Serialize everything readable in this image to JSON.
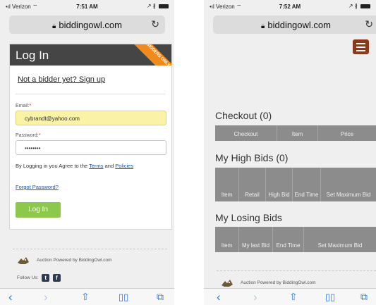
{
  "left": {
    "status": {
      "carrier": "Verizon",
      "time": "7:51 AM"
    },
    "url": "biddingowl.com",
    "login": {
      "title": "Log In",
      "ribbon": "BIDDERS ONLY",
      "signup_link": "Not a bidder yet? Sign up",
      "email_label": "Email:",
      "email_value": "cybrandt@yahoo.com",
      "password_label": "Password:",
      "password_value": "••••••••",
      "terms_prefix": "By Logging in you Agree to the",
      "terms_link": "Terms",
      "terms_and": "and",
      "policies_link": "Policies",
      "forgot_link": "Forgot Password?",
      "login_button": "Log In"
    },
    "footer": {
      "powered_by": "Auction Powered by BiddingOwl.com",
      "follow_us": "Follow Us:"
    }
  },
  "right": {
    "status": {
      "carrier": "Verizon",
      "time": "7:52 AM"
    },
    "url": "biddingowl.com",
    "checkout": {
      "title": "Checkout (0)",
      "columns": [
        "Checkout",
        "Item",
        "Price"
      ]
    },
    "high_bids": {
      "title": "My High Bids (0)",
      "columns": [
        "Item",
        "Retail",
        "High Bid",
        "End Time",
        "Set Maximum Bid"
      ]
    },
    "losing_bids": {
      "title": "My Losing Bids",
      "columns": [
        "Item",
        "My last Bid",
        "End Time",
        "Set Maximum Bid"
      ]
    },
    "footer": {
      "powered_by": "Auction Powered by BiddingOwl.com"
    }
  },
  "icons": {
    "wifi": "wifi-icon",
    "lock": "lock-icon",
    "reload": "reload-icon",
    "back": "back-arrow-icon",
    "forward": "forward-arrow-icon",
    "share": "share-icon",
    "bookmarks": "bookmarks-icon",
    "tabs": "tabs-icon",
    "menu": "hamburger-menu-icon",
    "owl": "owl-logo-icon"
  },
  "colors": {
    "header_dark": "#454545",
    "ribbon": "#f08a1c",
    "login_button": "#8cc84b",
    "email_fill": "#faf2a6",
    "table_header": "#8c8c8c",
    "menu_button": "#8a3a1c",
    "link": "#1a4fb3",
    "safari_blue": "#2a7ae2"
  }
}
